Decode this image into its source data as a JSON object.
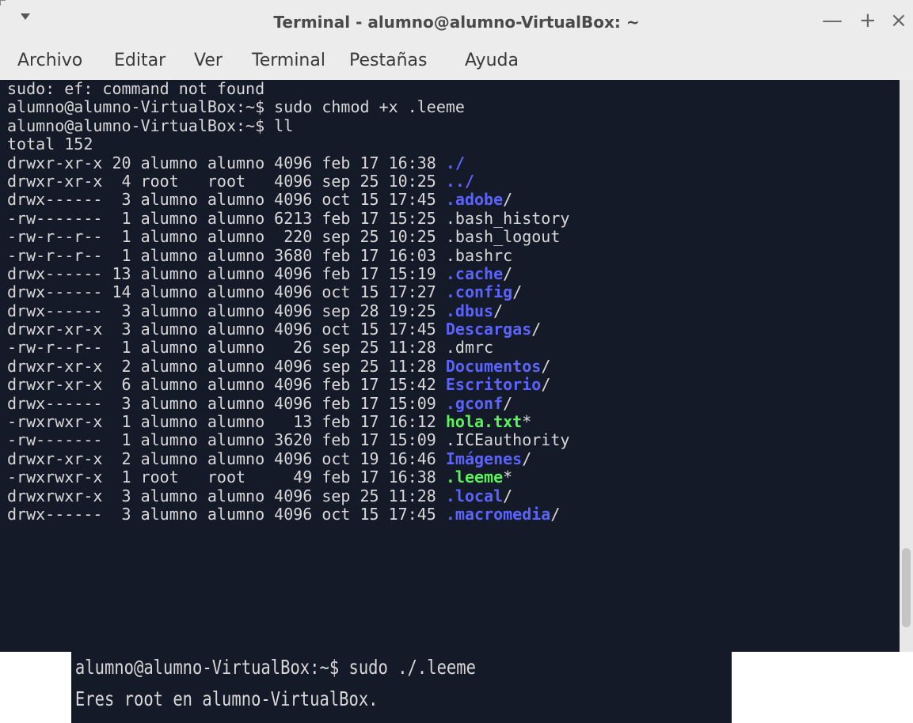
{
  "window": {
    "title": "Terminal - alumno@alumno-VirtualBox: ~",
    "controls": {
      "minimize": "—",
      "maximize": "+",
      "close": "×"
    }
  },
  "menubar": [
    "Archivo",
    "Editar",
    "Ver",
    "Terminal",
    "Pestañas",
    "Ayuda"
  ],
  "colors": {
    "terminal_bg": "#151a29",
    "text": "#d8d8d8",
    "directory": "#5b63ff",
    "executable": "#5cf25c"
  },
  "terminal": {
    "lines": [
      {
        "text": "sudo: ef: command not found"
      },
      {
        "text": "alumno@alumno-VirtualBox:~$ sudo chmod +x .leeme"
      },
      {
        "text": "alumno@alumno-VirtualBox:~$ ll"
      },
      {
        "text": "total 152"
      },
      {
        "prefix": "drwxr-xr-x 20 alumno alumno 4096 feb 17 16:38 ",
        "name": "./",
        "kind": "dir",
        "suffix": ""
      },
      {
        "prefix": "drwxr-xr-x  4 root   root   4096 sep 25 10:25 ",
        "name": "../",
        "kind": "dir",
        "suffix": ""
      },
      {
        "prefix": "drwx------  3 alumno alumno 4096 oct 15 17:45 ",
        "name": ".adobe",
        "kind": "dir",
        "suffix": "/"
      },
      {
        "prefix": "-rw-------  1 alumno alumno 6213 feb 17 15:25 ",
        "name": ".bash_history",
        "kind": "file",
        "suffix": ""
      },
      {
        "prefix": "-rw-r--r--  1 alumno alumno  220 sep 25 10:25 ",
        "name": ".bash_logout",
        "kind": "file",
        "suffix": ""
      },
      {
        "prefix": "-rw-r--r--  1 alumno alumno 3680 feb 17 16:03 ",
        "name": ".bashrc",
        "kind": "file",
        "suffix": ""
      },
      {
        "prefix": "drwx------ 13 alumno alumno 4096 feb 17 15:19 ",
        "name": ".cache",
        "kind": "dir",
        "suffix": "/"
      },
      {
        "prefix": "drwx------ 14 alumno alumno 4096 oct 15 17:27 ",
        "name": ".config",
        "kind": "dir",
        "suffix": "/"
      },
      {
        "prefix": "drwx------  3 alumno alumno 4096 sep 28 19:25 ",
        "name": ".dbus",
        "kind": "dir",
        "suffix": "/"
      },
      {
        "prefix": "drwxr-xr-x  3 alumno alumno 4096 oct 15 17:45 ",
        "name": "Descargas",
        "kind": "dir",
        "suffix": "/"
      },
      {
        "prefix": "-rw-r--r--  1 alumno alumno   26 sep 25 11:28 ",
        "name": ".dmrc",
        "kind": "file",
        "suffix": ""
      },
      {
        "prefix": "drwxr-xr-x  2 alumno alumno 4096 sep 25 11:28 ",
        "name": "Documentos",
        "kind": "dir",
        "suffix": "/"
      },
      {
        "prefix": "drwxr-xr-x  6 alumno alumno 4096 feb 17 15:42 ",
        "name": "Escritorio",
        "kind": "dir",
        "suffix": "/"
      },
      {
        "prefix": "drwx------  3 alumno alumno 4096 feb 17 15:09 ",
        "name": ".gconf",
        "kind": "dir",
        "suffix": "/"
      },
      {
        "prefix": "-rwxrwxr-x  1 alumno alumno   13 feb 17 16:12 ",
        "name": "hola.txt",
        "kind": "exe",
        "suffix": "*"
      },
      {
        "prefix": "-rw-------  1 alumno alumno 3620 feb 17 15:09 ",
        "name": ".ICEauthority",
        "kind": "file",
        "suffix": ""
      },
      {
        "prefix": "drwxr-xr-x  2 alumno alumno 4096 oct 19 16:46 ",
        "name": "Imágenes",
        "kind": "dir",
        "suffix": "/"
      },
      {
        "prefix": "-rwxrwxr-x  1 root   root     49 feb 17 16:38 ",
        "name": ".leeme",
        "kind": "exe",
        "suffix": "*"
      },
      {
        "prefix": "drwxrwxr-x  3 alumno alumno 4096 sep 25 11:28 ",
        "name": ".local",
        "kind": "dir",
        "suffix": "/"
      },
      {
        "prefix": "drwx------  3 alumno alumno 4096 oct 15 17:45 ",
        "name": ".macromedia",
        "kind": "dir",
        "suffix": "/"
      }
    ]
  },
  "inset": {
    "lines": [
      "alumno@alumno-VirtualBox:~$ sudo ./.leeme",
      "Eres root en alumno-VirtualBox."
    ]
  }
}
